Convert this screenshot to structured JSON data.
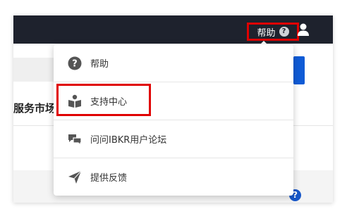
{
  "topbar": {
    "help_label": "帮助",
    "help_icon_glyph": "?",
    "user_icon": "user-icon",
    "background": "#1e222d"
  },
  "background_page": {
    "heading": "服务市场",
    "help_icon_glyph": "?"
  },
  "dropdown": {
    "items": [
      {
        "label": "帮助",
        "icon": "question-circle-icon"
      },
      {
        "label": "支持中心",
        "icon": "book-reader-icon"
      },
      {
        "label": "问问IBKR用户论坛",
        "icon": "chat-bubbles-icon"
      },
      {
        "label": "提供反馈",
        "icon": "paper-plane-icon"
      }
    ]
  },
  "colors": {
    "highlight": "#e00000",
    "accent_blue": "#0f5bd6",
    "icon_gray": "#555555"
  }
}
